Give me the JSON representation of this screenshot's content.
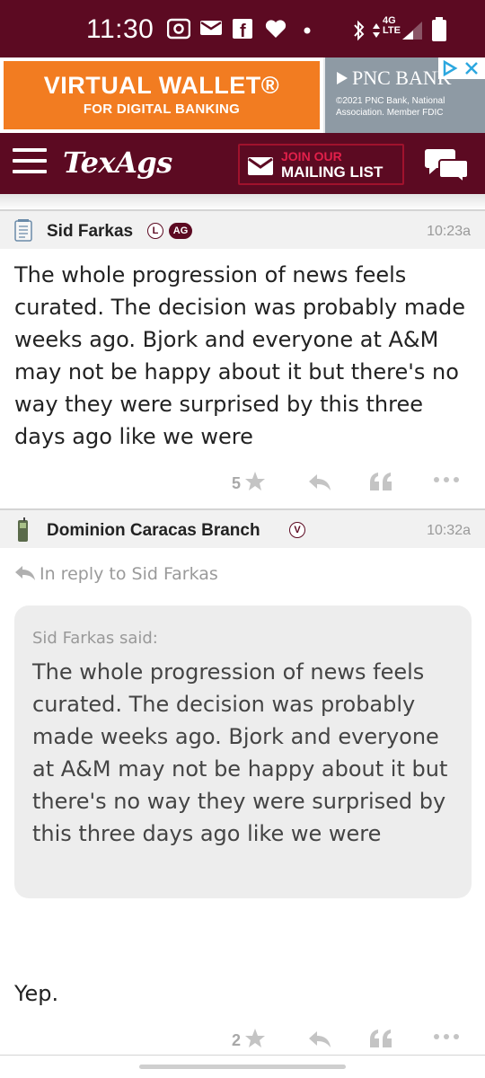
{
  "status_bar": {
    "time": "11:30",
    "network": "4G LTE"
  },
  "ad": {
    "title": "VIRTUAL WALLET®",
    "subtitle": "FOR DIGITAL BANKING",
    "bank": "PNC BANK",
    "legal": "©2021 PNC Bank, National Association. Member FDIC"
  },
  "header": {
    "logo": "TexAgs",
    "mailing_top": "JOIN OUR",
    "mailing_bottom": "MAILING LIST"
  },
  "posts": [
    {
      "author": "Sid Farkas",
      "badges": [
        "L",
        "AG"
      ],
      "time": "10:23a",
      "body": "The whole progression of news feels curated. The decision was probably made weeks ago. Bjork and everyone at A&M may not be happy about it but there's no way they were surprised by this three days ago like we were",
      "stars": "5"
    },
    {
      "author": "Dominion Caracas Branch",
      "badges": [
        "V"
      ],
      "time": "10:32a",
      "reply_to": "In reply to Sid Farkas",
      "quote_author": "Sid Farkas said:",
      "quote_text": "The whole progression of news feels curated. The decision was probably made weeks ago. Bjork and everyone at A&M may not be happy about it but there's no way they were surprised by this three days ago like we were",
      "body": "Yep.",
      "stars": "2"
    }
  ],
  "colors": {
    "maroon": "#5c0a22",
    "ad_orange": "#f27c21",
    "ad_gray": "#8e9aa4"
  }
}
